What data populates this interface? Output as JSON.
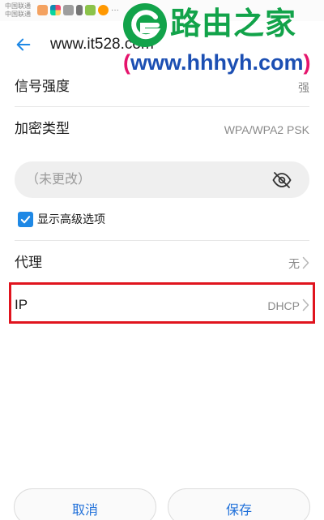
{
  "status_bar": {
    "carrier_1": "中国联通",
    "carrier_2": "中国联通",
    "more": "···"
  },
  "watermark": {
    "title": "路由之家",
    "url_open": "(",
    "url": "www.hhhyh.com",
    "url_close": ")"
  },
  "header": {
    "title": "www.it528.com"
  },
  "rows": {
    "signal": {
      "label": "信号强度",
      "value": "强"
    },
    "security": {
      "label": "加密类型",
      "value": "WPA/WPA2 PSK"
    },
    "proxy": {
      "label": "代理",
      "value": "无"
    },
    "ip": {
      "label": "IP",
      "value": "DHCP"
    }
  },
  "password": {
    "placeholder": "（未更改）"
  },
  "advanced": {
    "label": "显示高级选项",
    "checked": true
  },
  "buttons": {
    "cancel": "取消",
    "save": "保存"
  },
  "colors": {
    "accent": "#1e88e5",
    "highlight": "#e0141e",
    "watermark_green": "#12a34a",
    "watermark_blue": "#1c4fb3"
  },
  "icons": [
    "back-arrow-icon",
    "eye-off-icon",
    "checkmark-icon",
    "chevron-right-icon"
  ]
}
